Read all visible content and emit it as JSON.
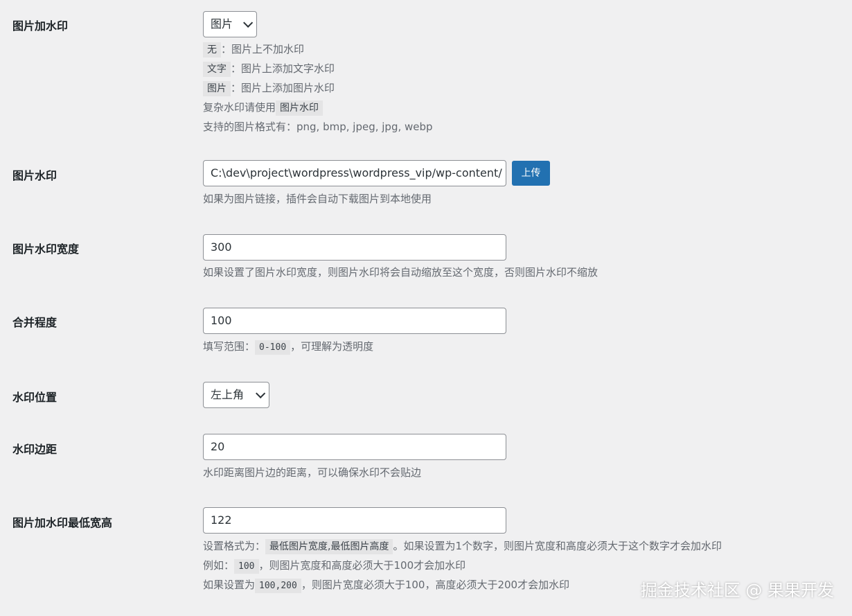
{
  "settings": {
    "watermark_type": {
      "label": "图片加水印",
      "value": "图片",
      "options": [
        {
          "code": "无",
          "text": "：图片上不加水印"
        },
        {
          "code": "文字",
          "text": "：图片上添加文字水印"
        },
        {
          "code": "图片",
          "text": "：图片上添加图片水印"
        }
      ],
      "complex_prefix": "复杂水印请使用",
      "complex_code": "图片水印",
      "formats": "支持的图片格式有：png, bmp, jpeg, jpg, webp"
    },
    "image_watermark": {
      "label": "图片水印",
      "value": "C:\\dev\\project\\wordpress\\wordpress_vip/wp-content/",
      "upload_label": "上传",
      "desc": "如果为图片链接，插件会自动下载图片到本地使用"
    },
    "watermark_width": {
      "label": "图片水印宽度",
      "value": "300",
      "desc": "如果设置了图片水印宽度，则图片水印将会自动缩放至这个宽度，否则图片水印不缩放"
    },
    "merge_level": {
      "label": "合并程度",
      "value": "100",
      "desc_prefix": "填写范围：",
      "desc_code": "0-100",
      "desc_suffix": "，可理解为透明度"
    },
    "position": {
      "label": "水印位置",
      "value": "左上角"
    },
    "margin": {
      "label": "水印边距",
      "value": "20",
      "desc": "水印距离图片边的距离，可以确保水印不会贴边"
    },
    "min_size": {
      "label": "图片加水印最低宽高",
      "value": "122",
      "line1_prefix": "设置格式为：",
      "line1_code": "最低图片宽度,最低图片高度",
      "line1_suffix": "。如果设置为1个数字，则图片宽度和高度必须大于这个数字才会加水印",
      "line2_prefix": "例如：",
      "line2_code": "100",
      "line2_suffix": "，则图片宽度和高度必须大于100才会加水印",
      "line3_prefix": "如果设置为",
      "line3_code": "100,200",
      "line3_suffix": "，则图片宽度必须大于100，高度必须大于200才会加水印"
    }
  },
  "watermark_text": "掘金技术社区 @ 果果开发"
}
